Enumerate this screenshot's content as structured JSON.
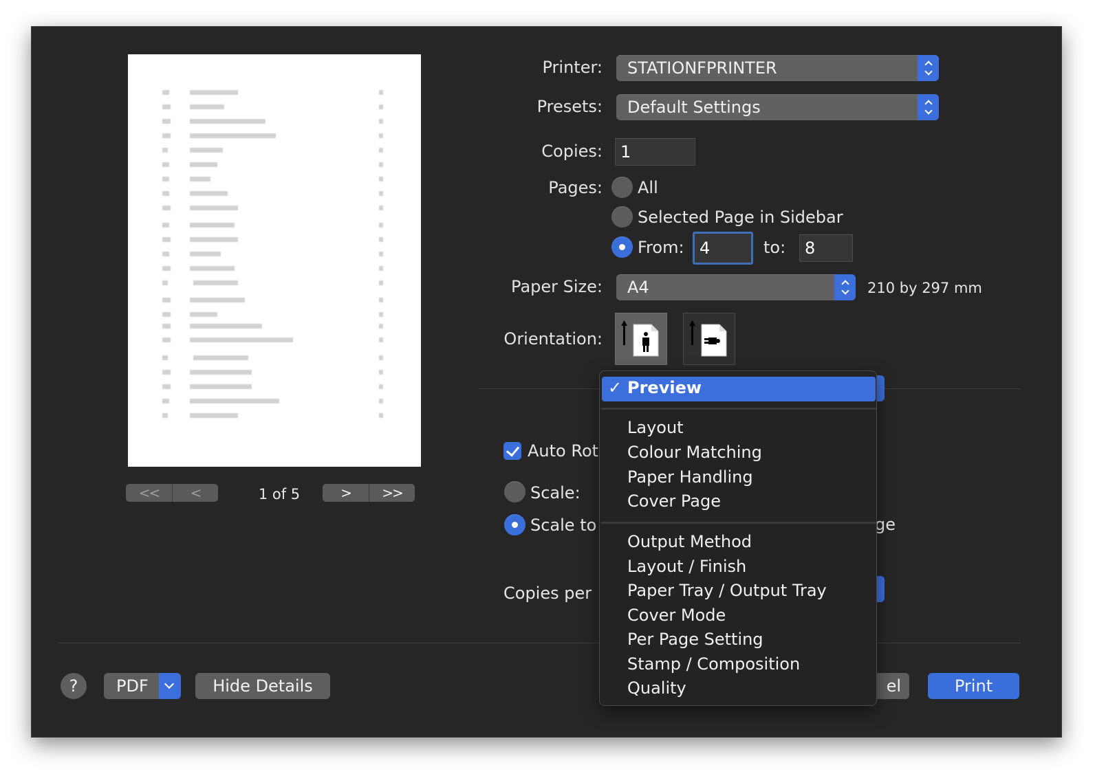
{
  "preview": {
    "page_info": "1 of 5",
    "nav_first": "<<",
    "nav_prev": "<",
    "nav_next": ">",
    "nav_last": ">>"
  },
  "printer": {
    "label": "Printer:",
    "value": "STATIONFPRINTER"
  },
  "presets": {
    "label": "Presets:",
    "value": "Default Settings"
  },
  "copies": {
    "label": "Copies:",
    "value": "1"
  },
  "pages": {
    "label": "Pages:",
    "all": "All",
    "selected_in_sidebar": "Selected Page in Sidebar",
    "from_label": "From:",
    "from_value": "4",
    "to_label": "to:",
    "to_value": "8",
    "selected_option": "from"
  },
  "paper_size": {
    "label": "Paper Size:",
    "value": "A4",
    "dimensions": "210 by 297 mm"
  },
  "orientation": {
    "label": "Orientation:",
    "selected": "portrait"
  },
  "options": {
    "auto_rotate": "Auto Rot",
    "auto_rotate_checked": true,
    "scale": "Scale:",
    "scale_to": "Scale to",
    "scale_to_tail": "ge",
    "copies_per": "Copies per",
    "selected_scale": "scale_to"
  },
  "panel_menu": {
    "selected": "Preview",
    "groups": [
      [
        "Layout",
        "Colour Matching",
        "Paper Handling",
        "Cover Page"
      ],
      [
        "Output Method",
        "Layout / Finish",
        "Paper Tray / Output Tray",
        "Cover Mode",
        "Per Page Setting",
        "Stamp / Composition",
        "Quality"
      ]
    ]
  },
  "footer": {
    "help": "?",
    "pdf": "PDF",
    "hide_details": "Hide Details",
    "cancel_partial": "el",
    "print": "Print"
  },
  "colors": {
    "accent": "#3c6fdb",
    "dialog_bg": "#262626",
    "control_bg": "#5e5e5e"
  }
}
